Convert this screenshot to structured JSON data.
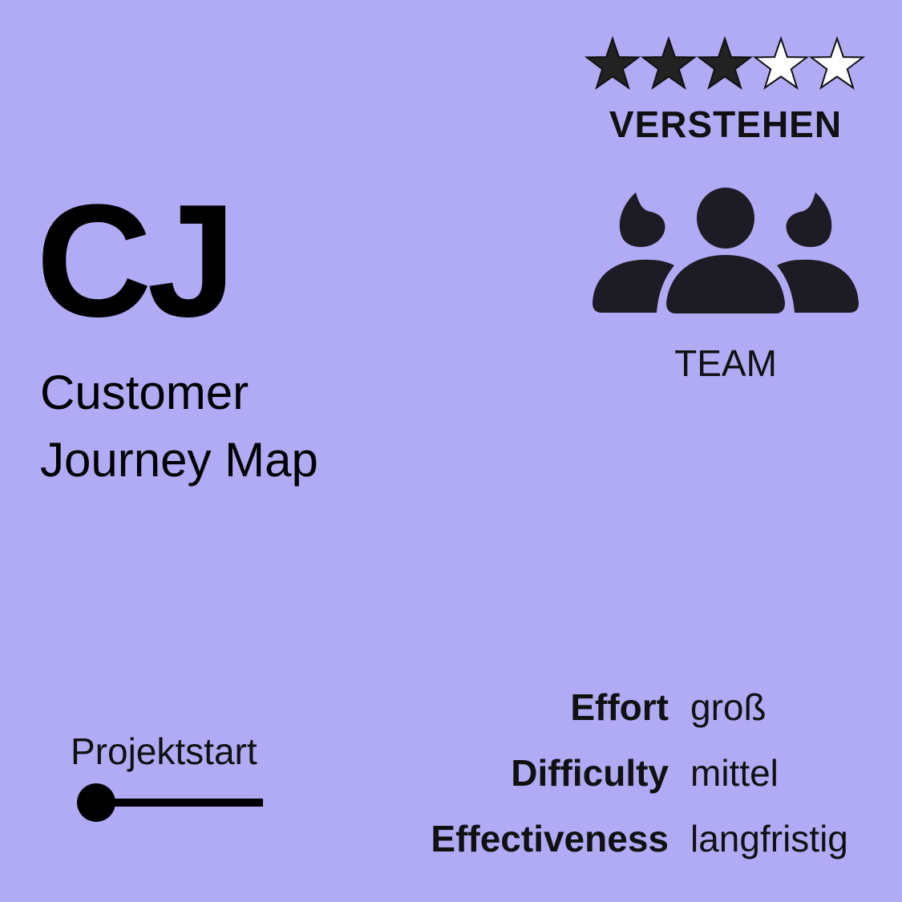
{
  "card": {
    "background_color": "#b1abf5",
    "text_color": "#111111"
  },
  "rating": {
    "value": 3,
    "max": 5,
    "filled_color": "#222222",
    "empty_color": "#ffffff"
  },
  "category": "VERSTEHEN",
  "participants": {
    "icon": "team-icon",
    "label": "TEAM"
  },
  "method": {
    "abbreviation": "CJ",
    "name_line1": "Customer",
    "name_line2": "Journey Map"
  },
  "phase": {
    "label": "Projektstart",
    "position": 0
  },
  "stats": [
    {
      "key": "Effort",
      "value": "groß"
    },
    {
      "key": "Difficulty",
      "value": "mittel"
    },
    {
      "key": "Effectiveness",
      "value": "langfristig"
    }
  ]
}
